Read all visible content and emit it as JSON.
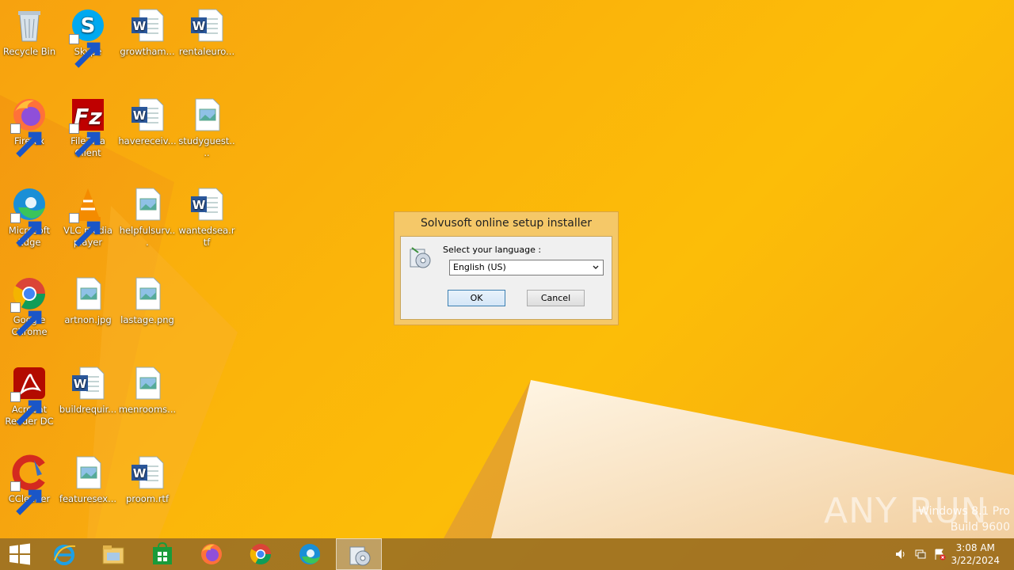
{
  "desktop_icons": [
    {
      "label": "Recycle Bin",
      "icon": "recycle-bin-icon"
    },
    {
      "label": "Skype",
      "icon": "skype-icon"
    },
    {
      "label": "growtham...",
      "icon": "word-doc-icon"
    },
    {
      "label": "rentaleuro...",
      "icon": "word-doc-icon"
    },
    {
      "label": "Firefox",
      "icon": "firefox-icon"
    },
    {
      "label": "FileZilla Client",
      "icon": "filezilla-icon"
    },
    {
      "label": "havereceiv...",
      "icon": "word-doc-icon"
    },
    {
      "label": "studyguest....",
      "icon": "image-file-icon"
    },
    {
      "label": "Microsoft Edge",
      "icon": "edge-icon"
    },
    {
      "label": "VLC media player",
      "icon": "vlc-icon"
    },
    {
      "label": "helpfulsurv...",
      "icon": "image-file-icon"
    },
    {
      "label": "wantedsea.rtf",
      "icon": "word-doc-icon"
    },
    {
      "label": "Google Chrome",
      "icon": "chrome-icon"
    },
    {
      "label": "artnon.jpg",
      "icon": "image-file-icon"
    },
    {
      "label": "lastage.png",
      "icon": "image-file-icon"
    },
    {
      "label": "Acrobat Reader DC",
      "icon": "acrobat-icon"
    },
    {
      "label": "buildrequir...",
      "icon": "word-doc-icon"
    },
    {
      "label": "menrooms...",
      "icon": "image-file-icon"
    },
    {
      "label": "CCleaner",
      "icon": "ccleaner-icon"
    },
    {
      "label": "featuresex...",
      "icon": "image-file-icon"
    },
    {
      "label": "proom.rtf",
      "icon": "word-doc-icon"
    }
  ],
  "dialog": {
    "title": "Solvusoft online setup installer",
    "prompt": "Select your language :",
    "language_selected": "English (US)",
    "ok_label": "OK",
    "cancel_label": "Cancel"
  },
  "taskbar": {
    "items": [
      "start-button",
      "internet-explorer",
      "file-explorer",
      "store",
      "firefox",
      "chrome",
      "edge",
      "setup-installer"
    ],
    "clock_time": "3:08 AM",
    "clock_date": "3/22/2024"
  },
  "watermark": {
    "line1": "Windows 8.1 Pro",
    "line2": "Build 9600",
    "brand": "ANY RUN"
  }
}
